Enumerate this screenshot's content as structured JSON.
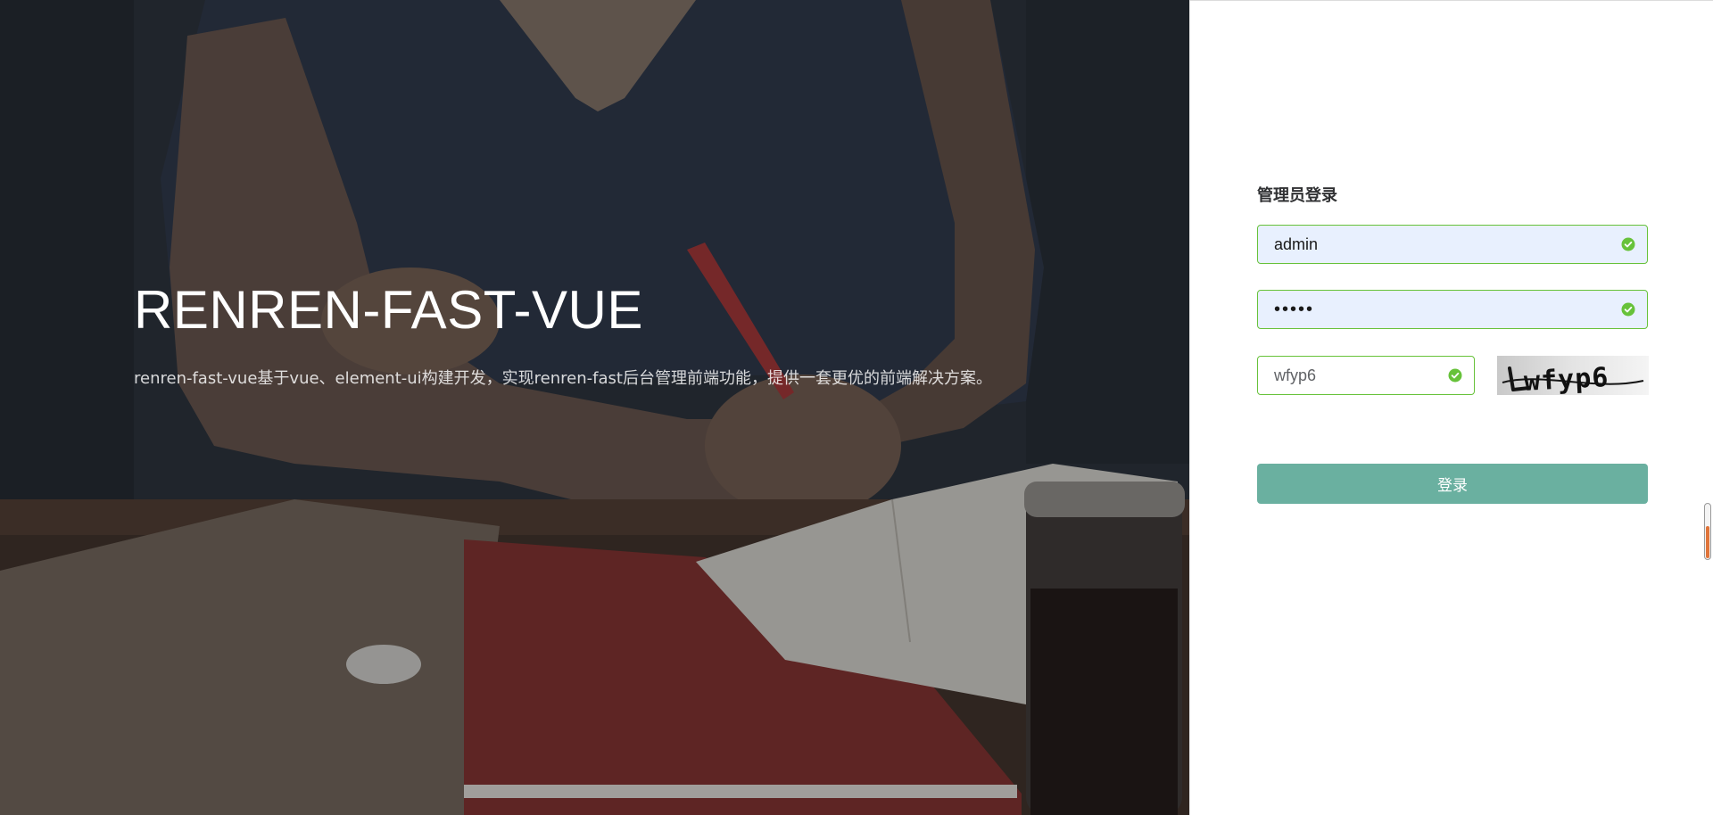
{
  "hero": {
    "title": "RENREN-FAST-VUE",
    "description": "renren-fast-vue基于vue、element-ui构建开发，实现renren-fast后台管理前端功能，提供一套更优的前端解决方案。",
    "background_image": "person writing in notebook on desk with laptop and glass jar"
  },
  "login": {
    "title": "管理员登录",
    "username": {
      "value": "admin",
      "status": "valid"
    },
    "password": {
      "value": "admin",
      "status": "valid"
    },
    "captcha": {
      "value": "wfyp6",
      "status": "valid",
      "image_text": "wfyp6"
    },
    "submit_label": "登录"
  },
  "colors": {
    "success": "#67c23a",
    "button": "#6ab0a0",
    "autofill_bg": "#e8f0fe",
    "hero_overlay": "#232830"
  },
  "icons": {
    "valid": "circle-check-icon"
  }
}
